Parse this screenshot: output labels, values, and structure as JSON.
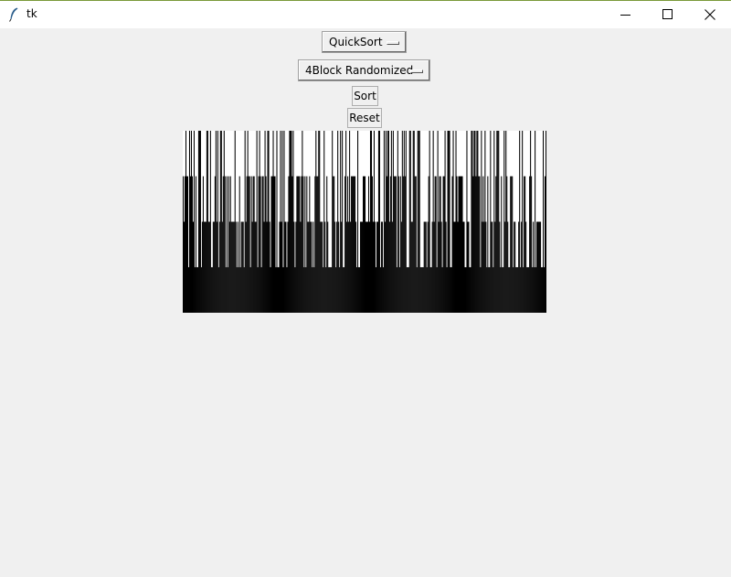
{
  "window": {
    "title": "tk",
    "icons": {
      "app": "feather-icon",
      "minimize": "minimize-icon",
      "maximize": "maximize-icon",
      "close": "close-icon"
    }
  },
  "controls": {
    "algorithm": "QuickSort",
    "distribution": "4Block Randomized",
    "sort_label": "Sort",
    "reset_label": "Reset"
  },
  "visualization": {
    "bar_count": 400,
    "value_levels": 4,
    "bar_color": "#000000",
    "background": "#ffffff"
  }
}
